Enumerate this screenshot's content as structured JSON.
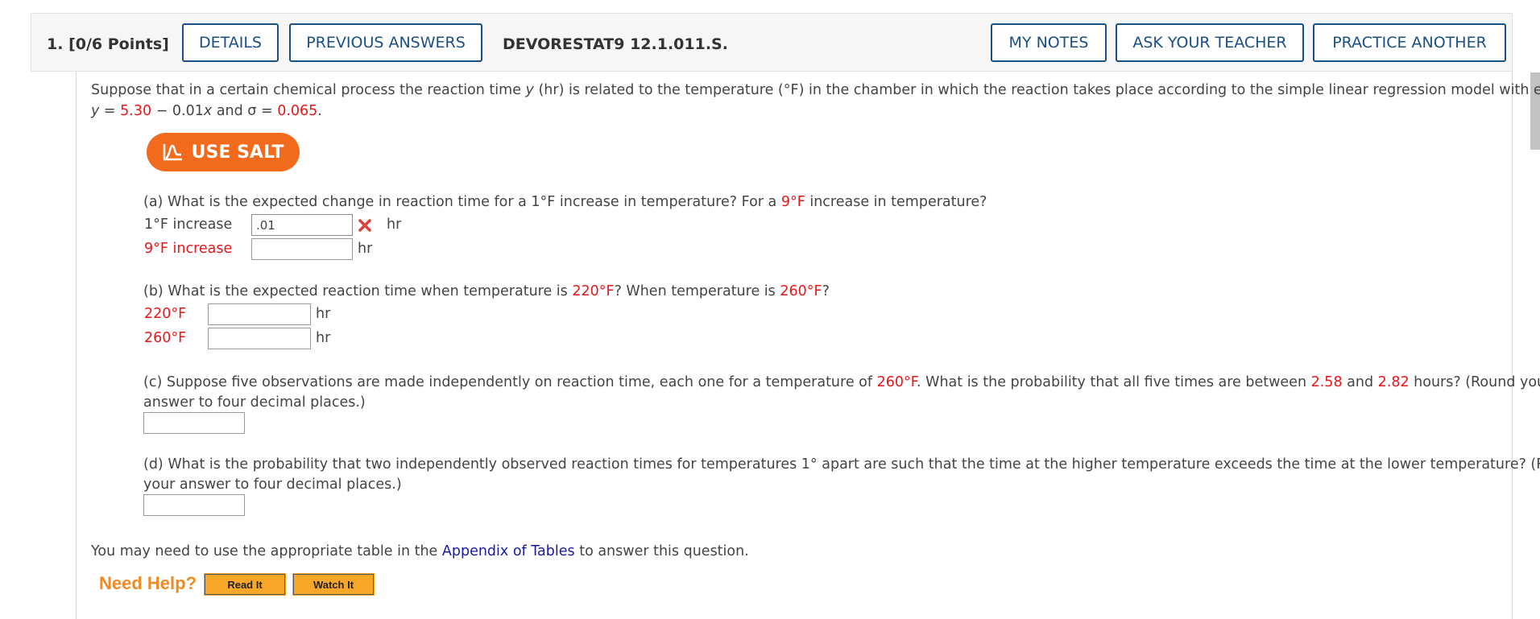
{
  "header": {
    "question_number": "1.",
    "points": "[0/6 Points]",
    "details_label": "DETAILS",
    "previous_answers_label": "PREVIOUS ANSWERS",
    "question_code": "DEVORESTAT9 12.1.011.S.",
    "my_notes_label": "MY NOTES",
    "ask_teacher_label": "ASK YOUR TEACHER",
    "practice_another_label": "PRACTICE ANOTHER"
  },
  "intro": {
    "text_1": "Suppose that in a certain chemical process the reaction time ",
    "var_y": "y",
    "text_2": " (hr) is related to the temperature (°F) in the chamber in which the reaction takes place according to the simple linear regression model with equation",
    "eq_lhs": "y",
    "eq_eq": " = ",
    "intercept": "5.30",
    "eq_mid": " − 0.01",
    "var_x": "x",
    "eq_and": " and σ = ",
    "sigma": "0.065",
    "eq_end": "."
  },
  "salt": {
    "label": "USE SALT"
  },
  "part_a": {
    "q_1": "(a) What is the expected change in reaction time for a 1°F increase in temperature? For a ",
    "q_red": "9°F",
    "q_2": " increase in temperature?",
    "row1_label": "1°F increase",
    "row1_value": ".01",
    "row1_unit": "hr",
    "row2_label": "9°F increase",
    "row2_value": "",
    "row2_unit": "hr"
  },
  "part_b": {
    "q_1": "(b) What is the expected reaction time when temperature is ",
    "q_red1": "220°F",
    "q_2": "? When temperature is ",
    "q_red2": "260°F",
    "q_3": "?",
    "row1_label": "220°F",
    "row1_value": "",
    "row1_unit": "hr",
    "row2_label": "260°F",
    "row2_value": "",
    "row2_unit": "hr"
  },
  "part_c": {
    "q_1": "(c) Suppose five observations are made independently on reaction time, each one for a temperature of ",
    "q_red1": "260°F",
    "q_2": ". What is the probability that all five times are between ",
    "q_red2": "2.58",
    "q_3": " and ",
    "q_red3": "2.82",
    "q_4": " hours? (Round your",
    "q_line2": "answer to four decimal places.)",
    "value": ""
  },
  "part_d": {
    "q_line1": "(d) What is the probability that two independently observed reaction times for temperatures 1° apart are such that the time at the higher temperature exceeds the time at the lower temperature? (Round",
    "q_line2": "your answer to four decimal places.)",
    "value": ""
  },
  "footer": {
    "text_1": "You may need to use the appropriate table in the ",
    "link": "Appendix of Tables",
    "text_2": " to answer this question.",
    "need_help": "Need Help?",
    "read_it": "Read It",
    "watch_it": "Watch It"
  },
  "colors": {
    "accent_blue": "#1a4f85",
    "salt_orange": "#f26a1b",
    "value_red": "#e8161b",
    "help_orange": "#f08a24"
  },
  "icons": {
    "salt": "salt-chart-icon",
    "incorrect": "incorrect-x-icon"
  }
}
